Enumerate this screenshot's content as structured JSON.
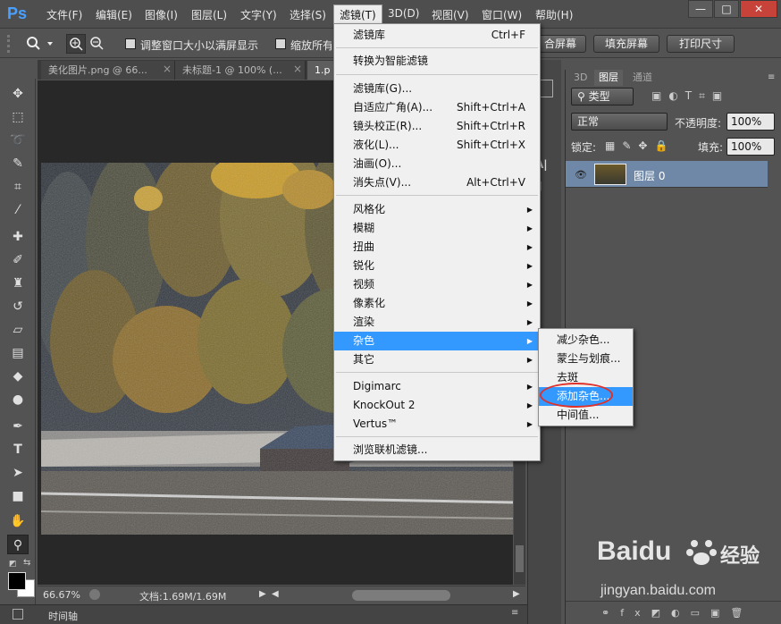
{
  "app": {
    "logo": "Ps"
  },
  "menubar": {
    "items": [
      "文件(F)",
      "编辑(E)",
      "图像(I)",
      "图层(L)",
      "文字(Y)",
      "选择(S)",
      "滤镜(T)",
      "3D(D)",
      "视图(V)",
      "窗口(W)",
      "帮助(H)"
    ],
    "window_controls": {
      "minimize": "—",
      "restore": "□",
      "close": "✕"
    }
  },
  "options": {
    "fit_window_label": "调整窗口大小以满屏显示",
    "zoom_all_label": "缩放所有",
    "fill_screen_label": "合屏幕",
    "fill_screen2_label": "填充屏幕",
    "print_size_label": "打印尺寸"
  },
  "tabs": [
    {
      "label": "美化图片.png @ 66..."
    },
    {
      "label": "未标题-1 @ 100% (..."
    },
    {
      "label": "1.p"
    }
  ],
  "tab_close": "×",
  "status": {
    "zoom": "66.67%",
    "doc": "文档:1.69M/1.69M"
  },
  "timeline": {
    "label": "时间轴"
  },
  "panels": {
    "tabs": [
      "3D",
      "图层",
      "通道"
    ],
    "kind_label": "类型",
    "blend_mode": "正常",
    "opacity_label": "不透明度:",
    "opacity_value": "100%",
    "lock_label": "锁定:",
    "fill_label": "填充:",
    "fill_value": "100%",
    "layer_name": "图层 0"
  },
  "filter_menu": {
    "group1": [
      {
        "label": "滤镜库",
        "shortcut": "Ctrl+F"
      }
    ],
    "group2": [
      {
        "label": "转换为智能滤镜"
      }
    ],
    "group3": [
      {
        "label": "滤镜库(G)..."
      },
      {
        "label": "自适应广角(A)...",
        "shortcut": "Shift+Ctrl+A"
      },
      {
        "label": "镜头校正(R)...",
        "shortcut": "Shift+Ctrl+R"
      },
      {
        "label": "液化(L)...",
        "shortcut": "Shift+Ctrl+X"
      },
      {
        "label": "油画(O)..."
      },
      {
        "label": "消失点(V)...",
        "shortcut": "Alt+Ctrl+V"
      }
    ],
    "group4": [
      "风格化",
      "模糊",
      "扭曲",
      "锐化",
      "视频",
      "像素化",
      "渲染",
      "杂色",
      "其它"
    ],
    "group5": [
      "Digimarc",
      "KnockOut 2",
      "Vertus™"
    ],
    "group6": [
      {
        "label": "浏览联机滤镜..."
      }
    ]
  },
  "noise_menu": [
    "减少杂色...",
    "蒙尘与划痕...",
    "去斑",
    "添加杂色...",
    "中间值..."
  ],
  "watermark": {
    "brand": "Baidu",
    "brand_cn": "经验",
    "url": "jingyan.baidu.com"
  },
  "colors": {
    "highlight": "#3399ff",
    "circle": "#e0302a",
    "ps_blue": "#4aa0ff"
  }
}
